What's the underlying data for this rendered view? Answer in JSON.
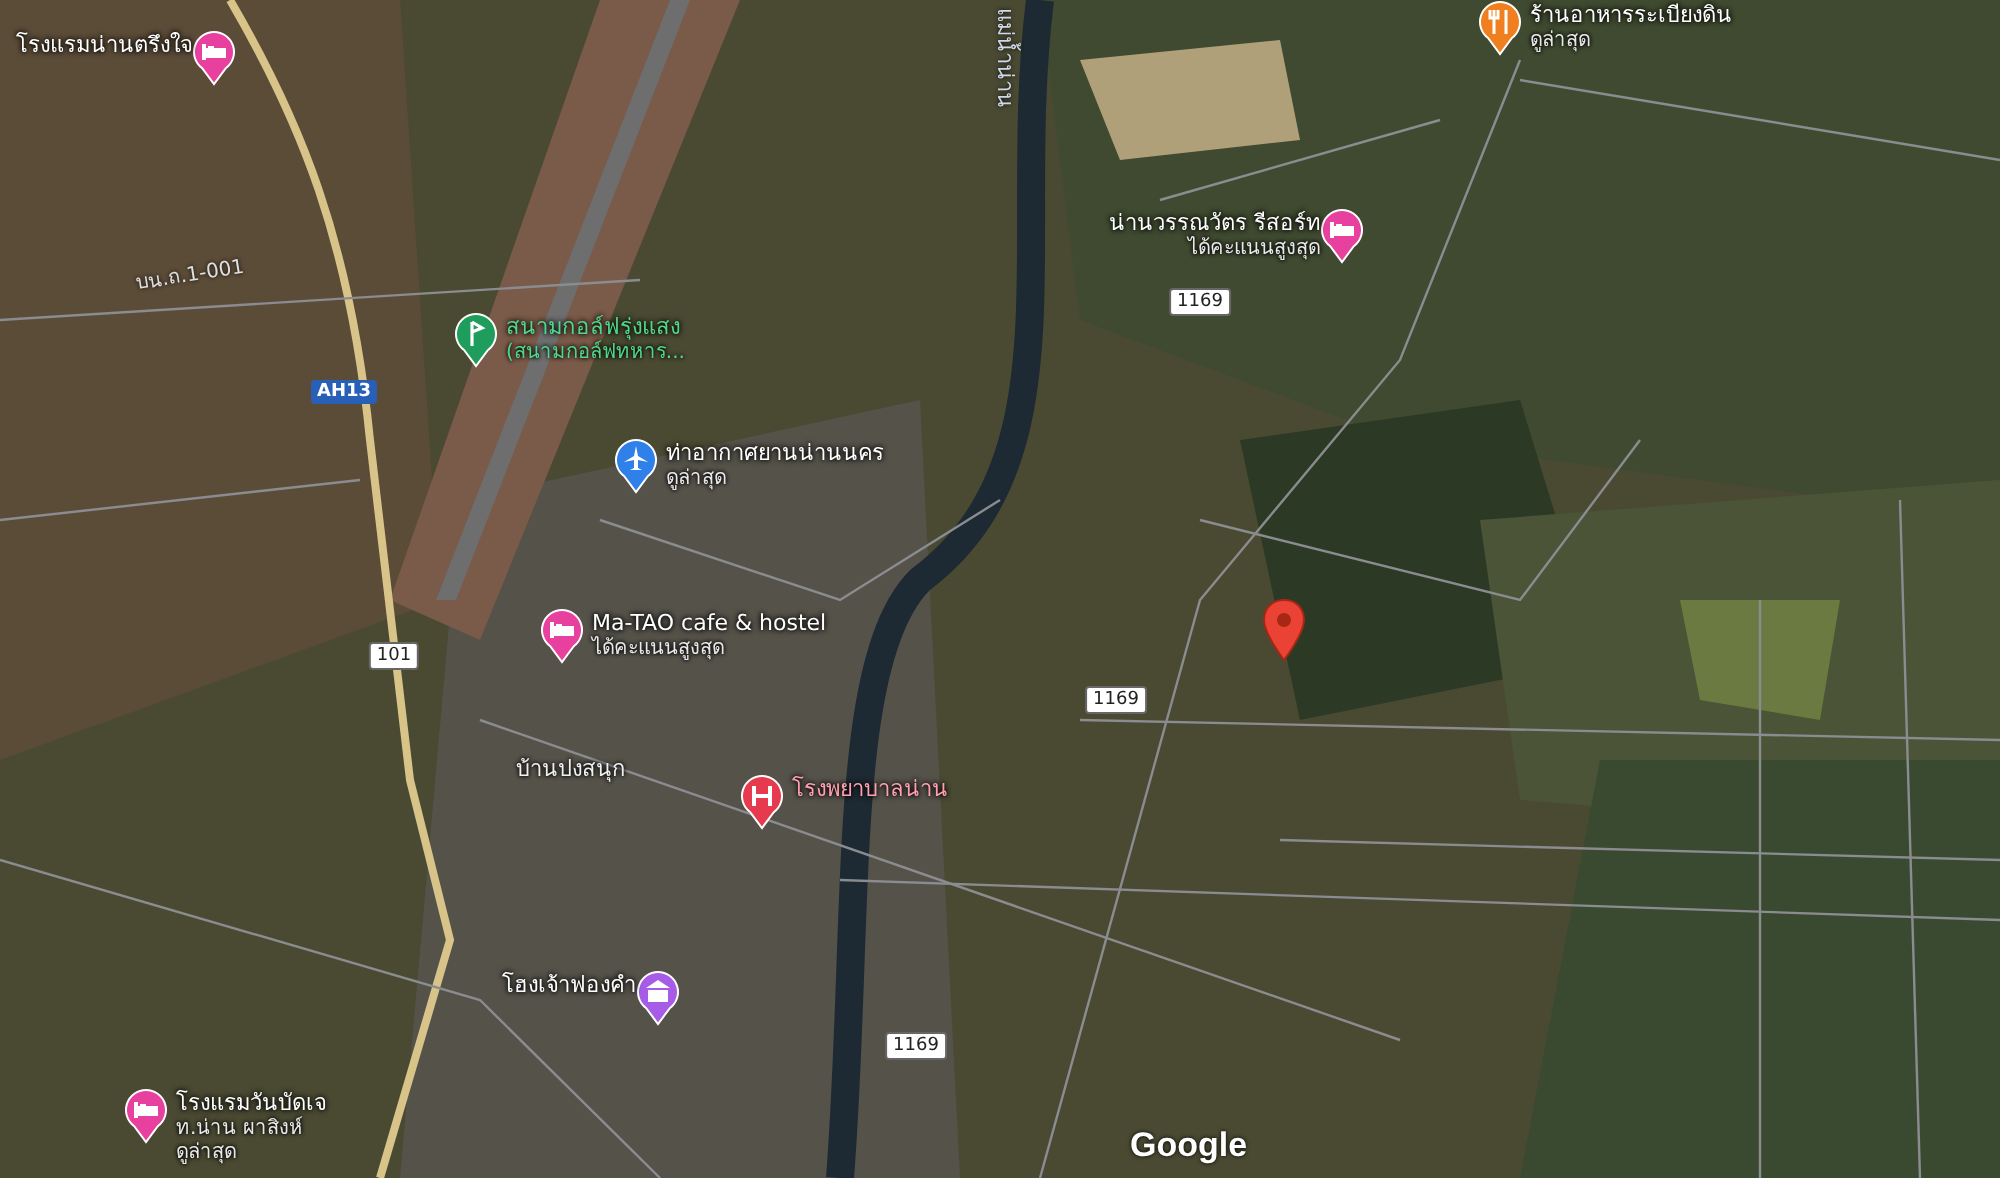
{
  "map": {
    "places": [
      {
        "kind": "hotel",
        "name": "โรงแรมน่านตรึงใจ"
      },
      {
        "kind": "golf",
        "name": "สนามกอล์ฟรุ่งแสง",
        "lines": [
          "(สนามกอล์ฟทหาร..."
        ]
      },
      {
        "kind": "airport",
        "name": "ท่าอากาศยานน่านนคร",
        "lines": [
          "ดูล่าสุด"
        ]
      },
      {
        "kind": "hotel",
        "name": "Ma-TAO cafe & hostel",
        "lines": [
          "ได้คะแนนสูงสุด"
        ]
      },
      {
        "kind": "hospital",
        "name": "โรงพยาบาลน่าน"
      },
      {
        "kind": "museum",
        "name": "โฮงเจ้าฟองคำ"
      },
      {
        "kind": "hotel",
        "name": "โรงแรมวันบัดเจ",
        "lines": [
          "ท.น่าน ผาสิงห์",
          "ดูล่าสุด"
        ]
      },
      {
        "kind": "hotel",
        "name": "น่านวรรณวัตร รีสอร์ท",
        "lines": [
          "ได้คะแนนสูงสุด"
        ]
      },
      {
        "kind": "restaurant",
        "name": "ร้านอาหารระเบียงดิน",
        "lines": [
          "ดูล่าสุด"
        ]
      }
    ],
    "road_labels": [
      {
        "kind": "text",
        "text": "บน.ถ.1-001"
      },
      {
        "kind": "asian-highway",
        "text": "AH13"
      },
      {
        "kind": "route",
        "text": "101"
      },
      {
        "kind": "route",
        "text": "1169"
      },
      {
        "kind": "route",
        "text": "1169"
      },
      {
        "kind": "route",
        "text": "1169"
      }
    ],
    "area_label": "บ้านปงสนุก",
    "river_label": "แม่น้ำน่าน",
    "attribution": "Google"
  }
}
